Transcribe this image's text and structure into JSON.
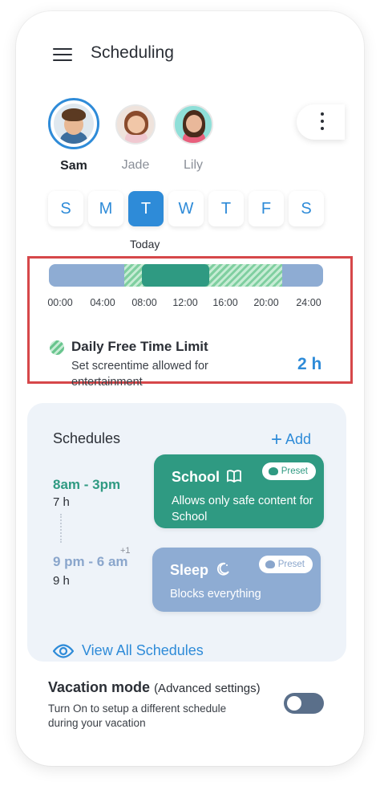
{
  "header": {
    "title": "Scheduling",
    "menu_icon": "hamburger-icon"
  },
  "profiles": [
    {
      "name": "Sam",
      "selected": true
    },
    {
      "name": "Jade",
      "selected": false
    },
    {
      "name": "Lily",
      "selected": false
    }
  ],
  "days": [
    {
      "label": "S",
      "active": false
    },
    {
      "label": "M",
      "active": false
    },
    {
      "label": "T",
      "active": true
    },
    {
      "label": "W",
      "active": false
    },
    {
      "label": "T",
      "active": false
    },
    {
      "label": "F",
      "active": false
    },
    {
      "label": "S",
      "active": false
    }
  ],
  "today_label": "Today",
  "timeline": {
    "ticks": [
      "00:00",
      "04:00",
      "08:00",
      "12:00",
      "16:00",
      "20:00",
      "24:00"
    ],
    "colors": {
      "blocked": "#8eacd3",
      "free_time": "#7fcfa0",
      "school": "#2f9a82"
    }
  },
  "free_time": {
    "title": "Daily Free Time Limit",
    "description": "Set screentime allowed for entertainment",
    "value": "2 h"
  },
  "schedules": {
    "title": "Schedules",
    "add_label": "Add",
    "items": [
      {
        "time": "8am - 3pm",
        "duration": "7 h",
        "name": "School",
        "description": "Allows only safe content for School",
        "badge": "Preset",
        "icon": "book-icon",
        "color": "#2f9a82"
      },
      {
        "time": "9 pm - 6 am",
        "time_suffix": "+1",
        "duration": "9 h",
        "name": "Sleep",
        "description": "Blocks everything",
        "badge": "Preset",
        "icon": "moon-icon",
        "color": "#8eacd3"
      }
    ],
    "view_all_label": "View All Schedules"
  },
  "vacation": {
    "title": "Vacation mode",
    "subtitle": "(Advanced settings)",
    "description": "Turn On to setup a different schedule during your vacation",
    "enabled": false
  },
  "accent_color": "#2e8bd8"
}
